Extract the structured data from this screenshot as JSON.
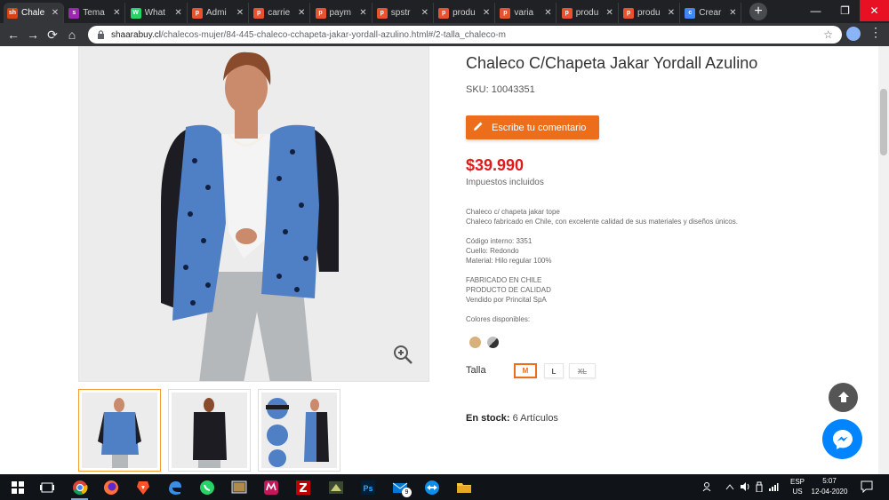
{
  "browser": {
    "tabs": [
      {
        "title": "Chale",
        "favicon": "sh",
        "favicon_color": "#d84315",
        "active": true
      },
      {
        "title": "Tema",
        "favicon": "s",
        "favicon_color": "#9c27b0",
        "active": false
      },
      {
        "title": "What",
        "favicon": "W",
        "favicon_color": "#25d366",
        "active": false
      },
      {
        "title": "Admi",
        "favicon": "p",
        "favicon_color": "#e8522f",
        "active": false
      },
      {
        "title": "carrie",
        "favicon": "p",
        "favicon_color": "#e8522f",
        "active": false
      },
      {
        "title": "paym",
        "favicon": "p",
        "favicon_color": "#e8522f",
        "active": false
      },
      {
        "title": "spstr",
        "favicon": "p",
        "favicon_color": "#e8522f",
        "active": false
      },
      {
        "title": "produ",
        "favicon": "p",
        "favicon_color": "#e8522f",
        "active": false
      },
      {
        "title": "varia",
        "favicon": "p",
        "favicon_color": "#e8522f",
        "active": false
      },
      {
        "title": "produ",
        "favicon": "p",
        "favicon_color": "#e8522f",
        "active": false
      },
      {
        "title": "produ",
        "favicon": "p",
        "favicon_color": "#e8522f",
        "active": false
      },
      {
        "title": "Crear",
        "favicon": "c",
        "favicon_color": "#4285f4",
        "active": false
      }
    ],
    "tab_close_glyph": "✕",
    "new_tab_glyph": "+",
    "window_controls": {
      "minimize": "—",
      "maximize": "❐",
      "close": "✕"
    },
    "nav": {
      "back": "←",
      "forward": "→",
      "reload": "⟳",
      "home": "⌂",
      "menu": "⋮"
    },
    "url_host": "shaarabuy.cl",
    "url_path": "/chalecos-mujer/84-445-chaleco-cchapeta-jakar-yordall-azulino.html#/2-talla_chaleco-m",
    "bookmark_glyph": "☆"
  },
  "product": {
    "title": "Chaleco C/Chapeta Jakar Yordall Azulino",
    "sku_label": "SKU:",
    "sku_value": "10043351",
    "comment_button": "Escribe tu comentario",
    "price": "$39.990",
    "tax_note": "Impuestos incluidos",
    "description_lines": [
      "Chaleco c/ chapeta jakar tope",
      "Chaleco fabricado en Chile, con excelente calidad de sus materiales y diseños únicos.",
      "",
      "Código interno: 3351",
      "Cuello: Redondo",
      "Material: Hilo regular 100%",
      "",
      "FABRICADO EN CHILE",
      "PRODUCTO DE CALIDAD",
      "Vendido por Princital SpA",
      "",
      "Colores disponibles:"
    ],
    "color_swatches": [
      {
        "name": "beige",
        "color": "#d7b07b"
      },
      {
        "name": "gris-negro",
        "color": "#888888"
      }
    ],
    "size_label": "Talla",
    "sizes": [
      {
        "label": "M",
        "selected": true,
        "available": true
      },
      {
        "label": "L",
        "selected": false,
        "available": true
      },
      {
        "label": "XL",
        "selected": false,
        "available": false
      }
    ],
    "stock_label": "En stock:",
    "stock_value": "6 Artículos"
  },
  "colors": {
    "accent": "#ec6d1a",
    "price": "#e01b1b",
    "garment_blue": "#4f7fc4",
    "messenger": "#0084ff"
  },
  "taskbar": {
    "apps": [
      "windows-start",
      "task-view",
      "chrome",
      "firefox",
      "brave",
      "edge",
      "whatsapp",
      "media-app",
      "shop-app",
      "filezilla",
      "game-app",
      "photoshop",
      "mail",
      "teamviewer",
      "file-explorer"
    ],
    "mail_badge": "9",
    "language": "ESP",
    "region": "US",
    "time": "5:07",
    "date": "12-04-2020"
  }
}
